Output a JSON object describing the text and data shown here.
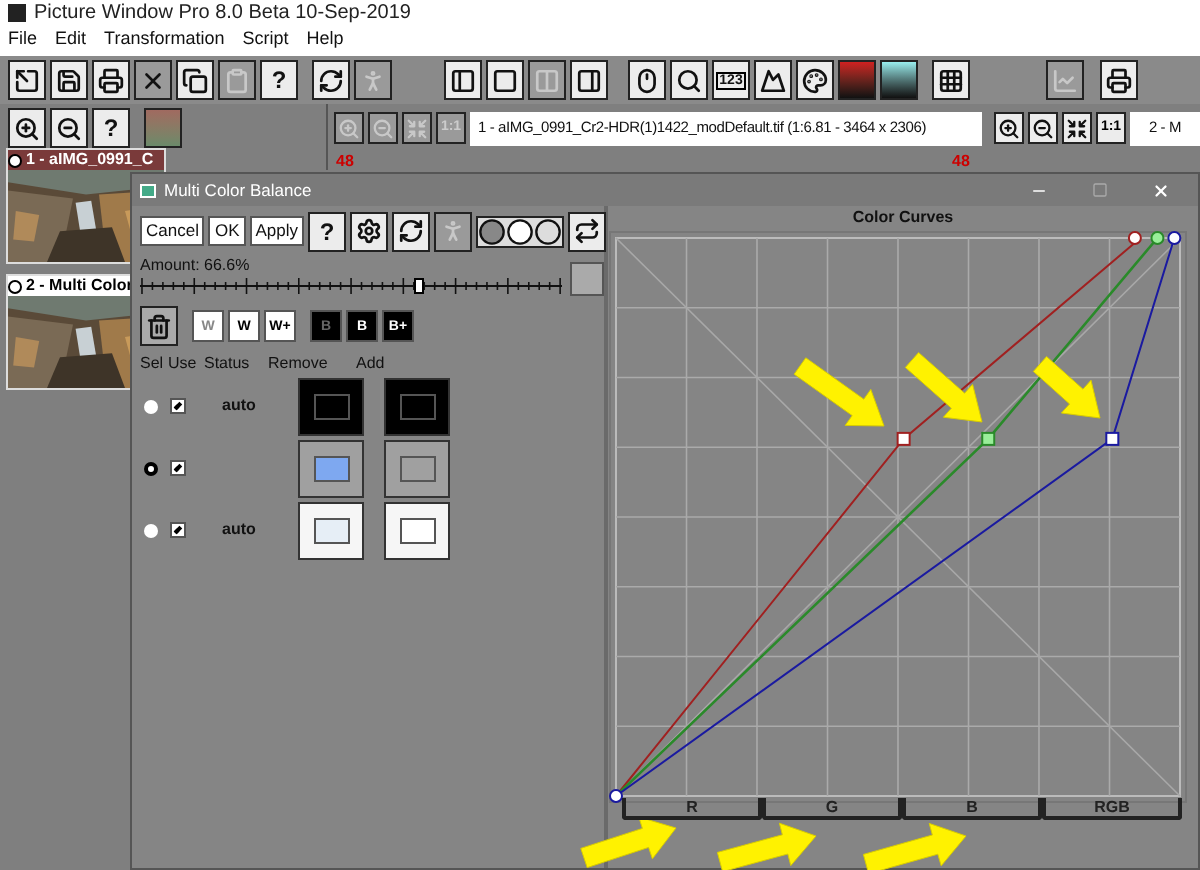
{
  "window": {
    "title": "Picture Window Pro 8.0 Beta 10-Sep-2019"
  },
  "menu": [
    "File",
    "Edit",
    "Transformation",
    "Script",
    "Help"
  ],
  "toolbar": {
    "help": "?",
    "counter": "123"
  },
  "side_tools": {
    "help": "?"
  },
  "image_tabs": [
    {
      "title": "1 - aIMG_0991_Cr2-HDR(1)1422_modDefault.tif (1:6.81 - 3464 x 2306)",
      "zoom_label": "1:1",
      "ruler": "48",
      "disabled": true
    },
    {
      "title": "2 - M",
      "zoom_label": "1:1",
      "ruler": "48",
      "disabled": false
    }
  ],
  "thumbnails": [
    {
      "label": "1 - aIMG_0991_C",
      "selected": true
    },
    {
      "label": "2 - Multi Color",
      "selected": false
    }
  ],
  "dialog": {
    "title": "Multi Color Balance",
    "buttons": [
      "Cancel",
      "OK",
      "Apply"
    ],
    "help": "?",
    "amount": {
      "label": "Amount: 66.6%",
      "level": 0.66
    },
    "white_buttons": [
      "W",
      "W",
      "W+"
    ],
    "black_buttons": [
      "B",
      "B",
      "B+"
    ],
    "columns": [
      "Sel",
      "Use",
      "Status",
      "Remove",
      "Add"
    ],
    "rows": [
      {
        "selected": false,
        "use": true,
        "status": "auto",
        "remove": {
          "color": "#000000"
        },
        "add": {
          "color": "#000000"
        }
      },
      {
        "selected": true,
        "use": true,
        "remove": {
          "color": "#7ea8f0"
        },
        "add": {
          "color": "#a0a0a0"
        }
      },
      {
        "selected": false,
        "use": true,
        "status": "auto",
        "remove": {
          "color": "#e6eef6"
        },
        "add": {
          "color": "#ffffff"
        }
      }
    ],
    "curves": {
      "title": "Color Curves",
      "channel_tabs": [
        "R",
        "G",
        "B",
        "RGB"
      ]
    }
  }
}
